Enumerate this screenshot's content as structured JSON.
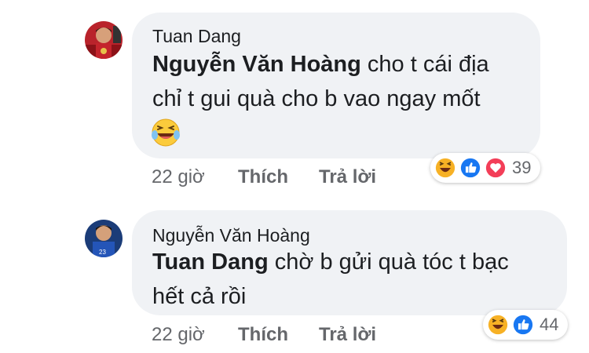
{
  "comments": [
    {
      "author": "Tuan Dang",
      "mention": "Nguyễn Văn Hoàng",
      "text_line1": " cho t cái địa",
      "text_line2": "chỉ t gui quà cho b vao ngay mốt",
      "has_emoji": true,
      "emoji": "laughing-tears",
      "time": "22 giờ",
      "like_label": "Thích",
      "reply_label": "Trả lời",
      "reactions": [
        "haha",
        "like",
        "love"
      ],
      "reaction_count": "39"
    },
    {
      "author": "Nguyễn Văn Hoàng",
      "mention": "Tuan Dang",
      "text_line1": " chờ b gửi quà tóc t bạc",
      "text_line2": "hết cả rồi",
      "has_emoji": false,
      "time": "22 giờ",
      "like_label": "Thích",
      "reply_label": "Trả lời",
      "reactions": [
        "haha",
        "like"
      ],
      "reaction_count": "44"
    }
  ],
  "colors": {
    "bubble": "#f0f2f5",
    "muted_text": "#65676b",
    "like_blue": "#1877f2",
    "love_red": "#f33e58",
    "haha_yellow": "#f7b125"
  }
}
